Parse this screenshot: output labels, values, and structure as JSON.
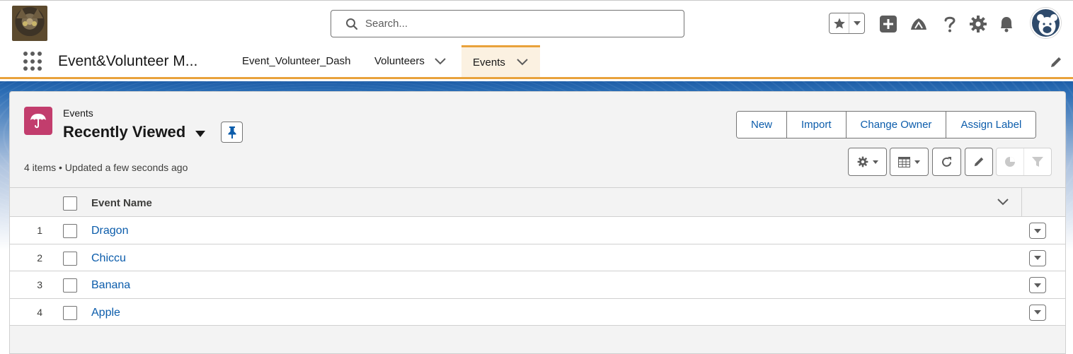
{
  "header": {
    "search_placeholder": "Search..."
  },
  "app_nav": {
    "app_name": "Event&Volunteer M...",
    "items": [
      {
        "label": "Event_Volunteer_Dash",
        "has_menu": false,
        "active": false
      },
      {
        "label": "Volunteers",
        "has_menu": true,
        "active": false
      },
      {
        "label": "Events",
        "has_menu": true,
        "active": true
      }
    ]
  },
  "list_view": {
    "object_label": "Events",
    "title": "Recently Viewed",
    "meta": "4 items • Updated a few seconds ago",
    "actions": [
      "New",
      "Import",
      "Change Owner",
      "Assign Label"
    ],
    "column_header": "Event Name",
    "rows": [
      {
        "num": "1",
        "name": "Dragon"
      },
      {
        "num": "2",
        "name": "Chiccu"
      },
      {
        "num": "3",
        "name": "Banana"
      },
      {
        "num": "4",
        "name": "Apple"
      }
    ]
  },
  "icons": {
    "object": "umbrella-icon",
    "toolbar": [
      "gear-icon",
      "table-view-icon",
      "refresh-icon",
      "pencil-icon",
      "chart-icon",
      "filter-icon"
    ]
  },
  "colors": {
    "accent": "#e9a23b",
    "link": "#0b5cab",
    "object_icon": "#c23d6d"
  }
}
